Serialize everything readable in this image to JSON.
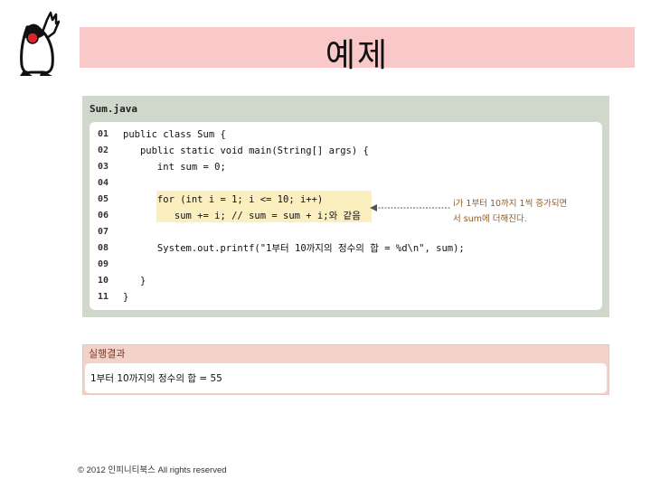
{
  "slide": {
    "title": "예제"
  },
  "code": {
    "filename": "Sum.java",
    "lines": [
      {
        "num": "01",
        "text": "public class Sum {"
      },
      {
        "num": "02",
        "text": "   public static void main(String[] args) {"
      },
      {
        "num": "03",
        "text": "      int sum = 0;"
      },
      {
        "num": "04",
        "text": ""
      },
      {
        "num": "05",
        "text": "      for (int i = 1; i <= 10; i++)"
      },
      {
        "num": "06",
        "text": "         sum += i; // sum = sum + i;와 같음"
      },
      {
        "num": "07",
        "text": ""
      },
      {
        "num": "08",
        "text": "      System.out.printf(\"1부터 10까지의 정수의 합 = %d\\n\", sum);"
      },
      {
        "num": "09",
        "text": ""
      },
      {
        "num": "10",
        "text": "   }"
      },
      {
        "num": "11",
        "text": "}"
      }
    ],
    "callout_line1": "i가 1부터 10까지 1씩 증가되면",
    "callout_line2": "서 sum에 더해진다."
  },
  "result": {
    "title": "실행결과",
    "output": "1부터 10까지의 정수의 합 = 55"
  },
  "footer": {
    "copyright": "© 2012 인피니티북스 All rights reserved"
  },
  "colors": {
    "title_band": "#f9c9c9",
    "code_panel": "#d0d8cb",
    "highlight": "#fbefc0",
    "result_panel": "#f3d3c9"
  }
}
